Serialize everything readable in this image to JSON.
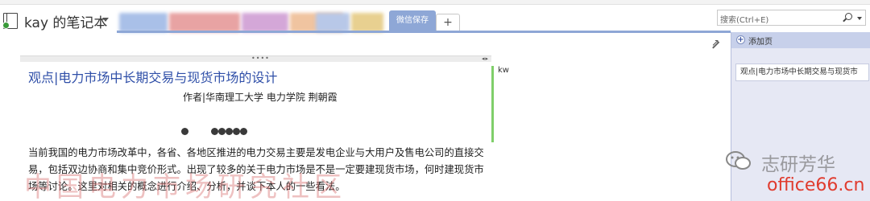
{
  "notebook": {
    "title": "kay 的笔记本"
  },
  "sections": {
    "active_tab": "微信保存",
    "add_tab": "+",
    "blurred_tab_colors": [
      "#a9c0e8",
      "#e8a3a3",
      "#d4a7d8",
      "#f0c4a0",
      "#b8c8e8",
      "#e8d090"
    ]
  },
  "search": {
    "placeholder": "搜索(Ctrl+E)"
  },
  "page_pane": {
    "add_page_label": "添加页",
    "add_page_icon": "+",
    "pages": [
      {
        "label": "观点|电力市场中长期交易与现货市"
      }
    ]
  },
  "content": {
    "side_note": "kw",
    "handle_dots": "••••",
    "handle_arrows": "◂▸",
    "title": "观点|电力市场中长期交易与现货市场的设计",
    "author": "作者|华南理工大学 电力学院 荆朝霞",
    "body": "当前我国的电力市场改革中，各省、各地区推进的电力交易主要是发电企业与大用户及售电公司的直接交易，包括双边协商和集中竞价形式。出现了较多的关于电力市场是不是一定要建现货市场，何时建现货市场等讨论。这里对相关的概念进行介绍、分析，并谈下本人的一些看法。"
  },
  "watermarks": {
    "big": "中国电力市场研究社区",
    "zhiyan": "志研芳华",
    "office": "office66.cn"
  },
  "colors": {
    "accent": "#8ea7d6",
    "title_blue": "#2f4fa8",
    "pane_bg": "#e6e8f4",
    "green_bar": "#7fcf6a"
  }
}
